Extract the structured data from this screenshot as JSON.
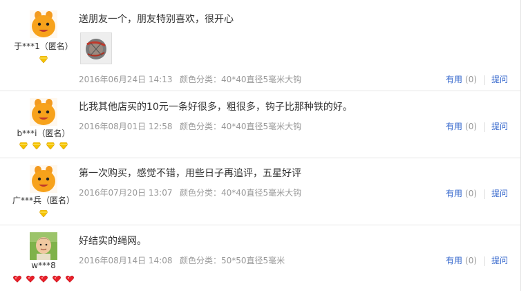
{
  "labels": {
    "useful": "有用",
    "ask": "提问"
  },
  "reviews": [
    {
      "user": "于***1（匿名）",
      "avatar": "orange-mascot",
      "badge_count": 1,
      "badge_type": "yellow-diamond",
      "text": "送朋友一个，朋友特别喜欢，很开心",
      "has_photo": true,
      "date": "2016年06月24日 14:13",
      "spec": "颜色分类：40*40直径5毫米大钩",
      "useful_count": "(0)"
    },
    {
      "user": "b***i（匿名）",
      "avatar": "orange-mascot",
      "badge_count": 4,
      "badge_type": "yellow-diamond",
      "text": "比我其他店买的10元一条好很多，粗很多，钩子比那种铁的好。",
      "has_photo": false,
      "date": "2016年08月01日 12:58",
      "spec": "颜色分类：40*40直径5毫米大钩",
      "useful_count": "(0)"
    },
    {
      "user": "广***兵（匿名）",
      "avatar": "orange-mascot",
      "badge_count": 1,
      "badge_type": "yellow-diamond",
      "text": "第一次购买，感觉不错，用些日子再追评，五星好评",
      "has_photo": false,
      "date": "2016年07月20日 13:07",
      "spec": "颜色分类：40*40直径5毫米大钩",
      "useful_count": "(0)"
    },
    {
      "user": "w***8",
      "avatar": "child-photo",
      "badge_count": 5,
      "badge_type": "red-heart",
      "text": "好结实的绳网。",
      "has_photo": false,
      "date": "2016年08月14日 14:08",
      "spec": "颜色分类：50*50直径5毫米",
      "useful_count": "(0)"
    }
  ]
}
